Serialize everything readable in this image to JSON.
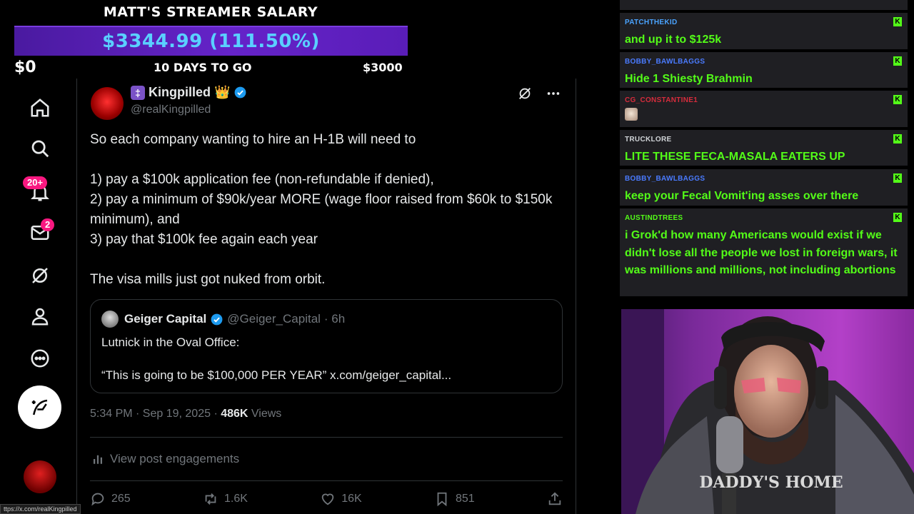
{
  "salary": {
    "title": "MATT'S STREAMER SALARY",
    "amount": "$3344.99 (111.50%)",
    "min_label": "$0",
    "days_label": "10 DAYS TO GO",
    "max_label": "$3000",
    "progress_fraction": 1.115,
    "bar_color": "#6523c9",
    "amount_color": "#5ad0ff"
  },
  "nav": {
    "items": [
      "home-icon",
      "search-icon",
      "notifications-icon",
      "messages-icon",
      "grok-icon",
      "profile-icon",
      "more-icon"
    ],
    "notifications_badge": "20+",
    "messages_badge": "2",
    "status_url": "ttps://x.com/realKingpilled"
  },
  "tweet": {
    "display_name": "Kingpilled",
    "name_emoji": "👑",
    "handle": "@realKingpilled",
    "body": "So each company wanting to hire an H-1B will need to\n\n1) pay a $100k application fee (non-refundable if denied),\n2) pay a minimum of $90k/year MORE (wage floor raised from $60k to $150k minimum), and\n3) pay that $100k fee again each year\n\nThe visa mills just got nuked from orbit.",
    "quote": {
      "name": "Geiger Capital",
      "handle": "@Geiger_Capital",
      "time": "· 6h",
      "text": "Lutnick in the Oval Office:\n\n“This is going to be $100,000 PER YEAR” x.com/geiger_capital..."
    },
    "meta_time": "5:34 PM · Sep 19, 2025 · ",
    "views_count": "486K",
    "views_label": " Views",
    "engagements_label": "View post engagements",
    "replies": "265",
    "reposts": "1.6K",
    "likes": "16K",
    "bookmarks": "851"
  },
  "chat": {
    "messages": [
      {
        "user": "PATCHTHEKID",
        "user_color": "#4aa3ff",
        "text": "and up it to $125k"
      },
      {
        "user": "BOBBY_BAWLBAGGS",
        "user_color": "#4a7bff",
        "text": "Hide 1 Shiesty Brahmin"
      },
      {
        "user": "CG_CONSTANTINE1",
        "user_color": "#d62c3c",
        "text": ""
      },
      {
        "user": "TRUCKLORE",
        "user_color": "#cfd3d6",
        "text": "LITE THESE FECA-MASALA EATERS UP"
      },
      {
        "user": "BOBBY_BAWLBAGGS",
        "user_color": "#4a7bff",
        "text": "keep your Fecal Vomit'ing asses over there"
      },
      {
        "user": "AUSTINDTREES",
        "user_color": "#53fc18",
        "text": "i Grok'd how many Americans would exist if we didn't lose all the people we lost in foreign wars, it was millions and millions, not including abortions"
      }
    ],
    "badge_label": "K",
    "text_color": "#53fc18"
  },
  "webcam": {
    "shirt_text": "DADDY'S HOME"
  }
}
